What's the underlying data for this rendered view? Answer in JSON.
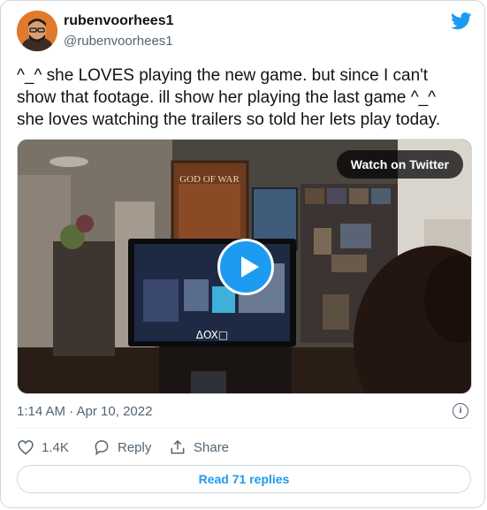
{
  "author": {
    "display_name": "rubenvoorhees1",
    "handle": "@rubenvoorhees1"
  },
  "tweet": {
    "text_lines": [
      "^_^ she LOVES playing the new game. but since I can't",
      "show that footage. ill show her playing the last game ^_^",
      "she loves watching the trailers so told her lets play today."
    ],
    "timestamp": "1:14 AM · Apr 10, 2022"
  },
  "media": {
    "watch_label": "Watch on Twitter",
    "poster_title": "GOD OF WAR",
    "tv_logo": "ΔOX□"
  },
  "actions": {
    "likes": "1.4K",
    "reply_label": "Reply",
    "share_label": "Share"
  },
  "footer": {
    "read_replies": "Read 71 replies"
  },
  "colors": {
    "accent": "#1d9bf0",
    "secondary_text": "#536471",
    "border": "#cfd9de",
    "avatar_bg": "#e07a2c"
  },
  "icons": [
    "twitter-bird-icon",
    "play-icon",
    "info-icon",
    "heart-icon",
    "reply-icon",
    "share-icon"
  ]
}
